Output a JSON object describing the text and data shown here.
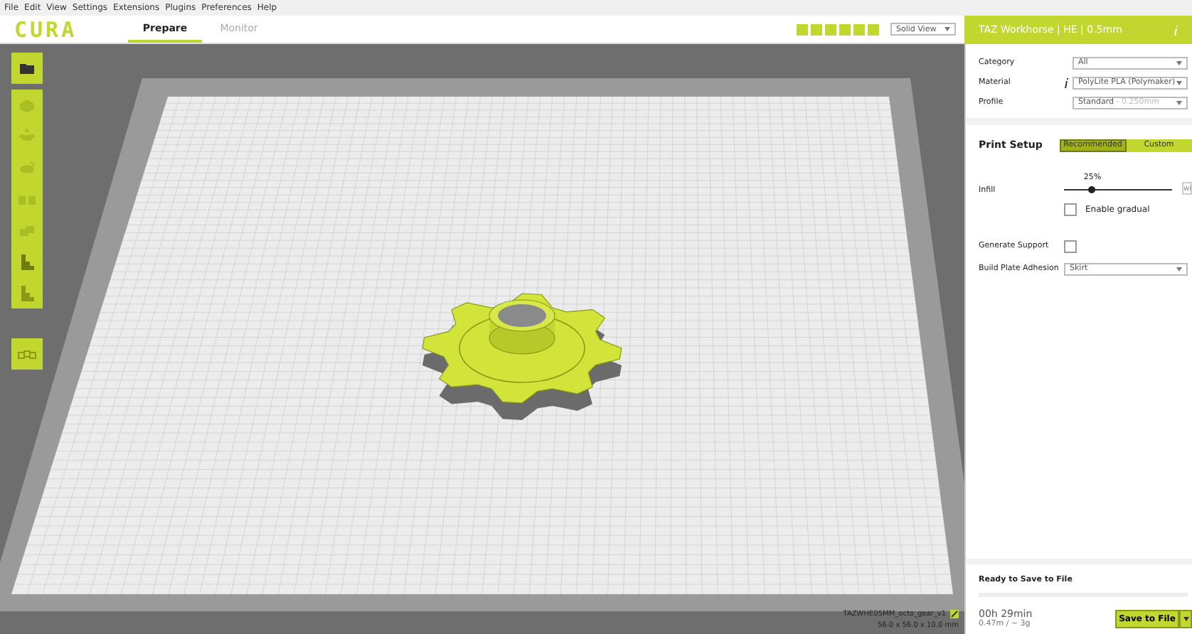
{
  "menu": [
    "File",
    "Edit",
    "View",
    "Settings",
    "Extensions",
    "Plugins",
    "Preferences",
    "Help"
  ],
  "logo": "CURA",
  "tabs": [
    {
      "label": "Prepare",
      "selected": true
    },
    {
      "label": "Monitor",
      "selected": false
    }
  ],
  "view_mode": "Solid View",
  "printer": "TAZ Workhorse | HE | 0.5mm",
  "settings": [
    {
      "label": "Category",
      "value": "All",
      "info": false
    },
    {
      "label": "Material",
      "value": "PolyLite PLA (Polymaker)",
      "info": true
    },
    {
      "label": "Profile",
      "value": "Standard",
      "hint": "- 0.250mm",
      "info": false
    }
  ],
  "print_setup": {
    "title": "Print Setup",
    "modes": [
      {
        "label": "Recommended",
        "selected": true
      },
      {
        "label": "Custom",
        "selected": false
      }
    ]
  },
  "infill": {
    "label": "Infill",
    "reading": "25%",
    "level": 0.25,
    "side_button": "wi",
    "gradual": {
      "label": "Enable gradual",
      "checked": false
    }
  },
  "support": {
    "label": "Generate Support",
    "checked": false
  },
  "adhesion": {
    "label": "Build Plate Adhesion",
    "value": "Skirt"
  },
  "model": {
    "name": "TAZWHE05MM_octo_gear_v1",
    "dimensions": "56.0 x 56.0 x 10.0 mm"
  },
  "footer": {
    "status": "Ready to Save to File",
    "time": "00h 29min",
    "usage": "0.47m / ~ 3g",
    "button": "Save to File"
  }
}
